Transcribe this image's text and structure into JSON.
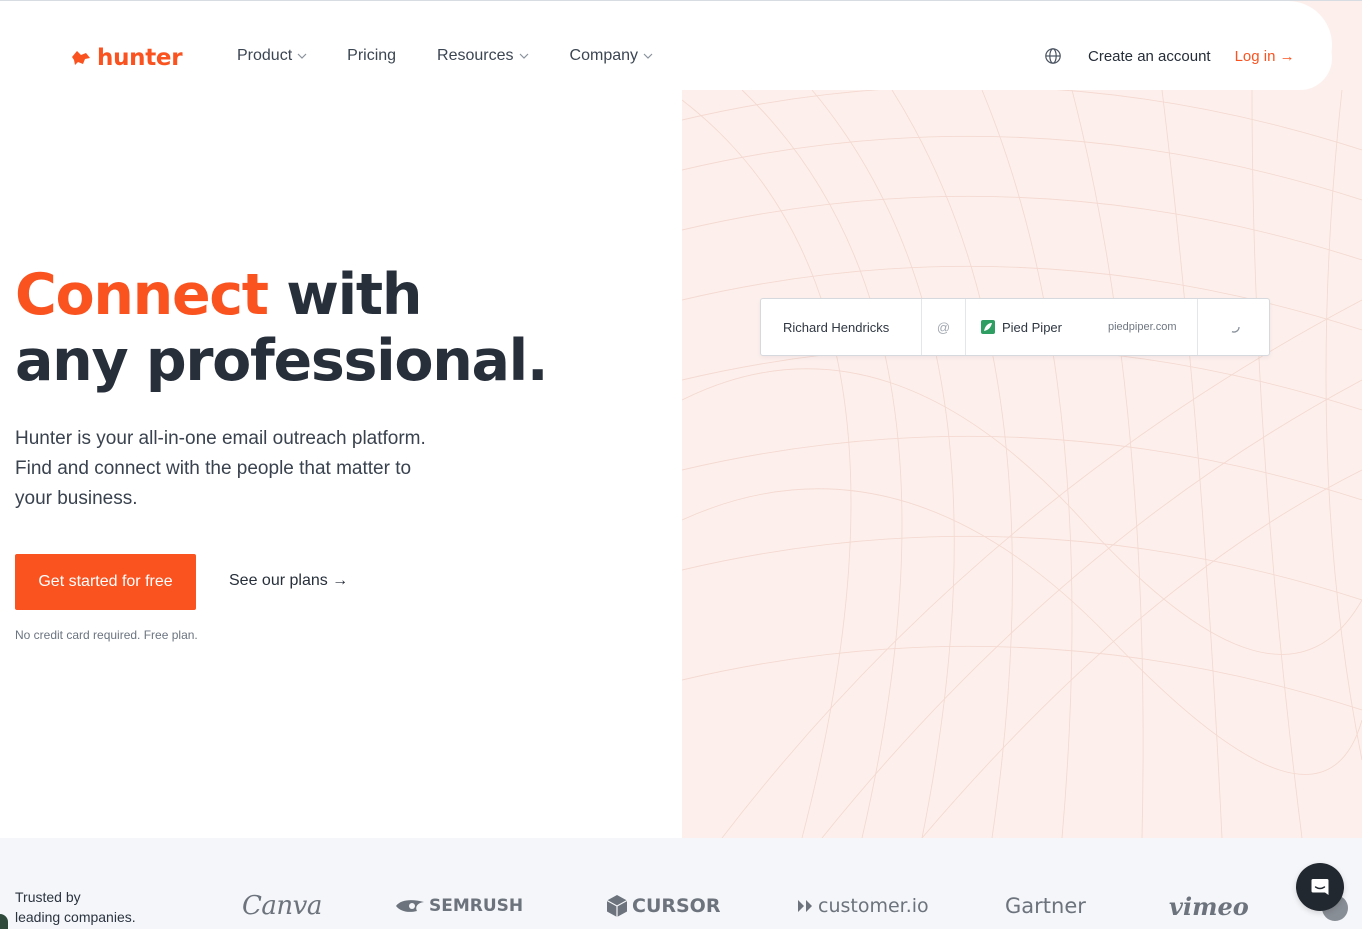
{
  "header": {
    "logo_text": "hunter",
    "nav": [
      {
        "label": "Product",
        "has_dropdown": true
      },
      {
        "label": "Pricing",
        "has_dropdown": false
      },
      {
        "label": "Resources",
        "has_dropdown": true
      },
      {
        "label": "Company",
        "has_dropdown": true
      }
    ],
    "language_icon": "globe-icon",
    "create_account_label": "Create an account",
    "login_label": "Log in →"
  },
  "hero": {
    "headline_accent": "Connect",
    "headline_line1_rest": " with",
    "headline_line2": "any professional.",
    "description_line1": "Hunter is your all-in-one email outreach platform.",
    "description_line2": "Find and connect with the people that matter to",
    "description_line3": "your business.",
    "cta_label": "Get started for free",
    "plans_label": "See our plans →",
    "note": "No credit card required. Free plan."
  },
  "demo_search": {
    "name": "Richard Hendricks",
    "at_symbol": "@",
    "company": "Pied Piper",
    "domain": "piedpiper.com",
    "status_icon": "loading-spinner-icon"
  },
  "trusted": {
    "label_line1": "Trusted by",
    "label_line2": "leading companies.",
    "brands": [
      "Canva",
      "SEMRUSH",
      "CURSOR",
      "customer.io",
      "Gartner",
      "vimeo"
    ]
  },
  "chat": {
    "icon": "chat-icon"
  },
  "colors": {
    "accent": "#fa5320",
    "heading": "#272f3b",
    "hero_background": "#fdf0ec",
    "trusted_background": "#f4f6f9",
    "chat_button": "#22282f"
  }
}
